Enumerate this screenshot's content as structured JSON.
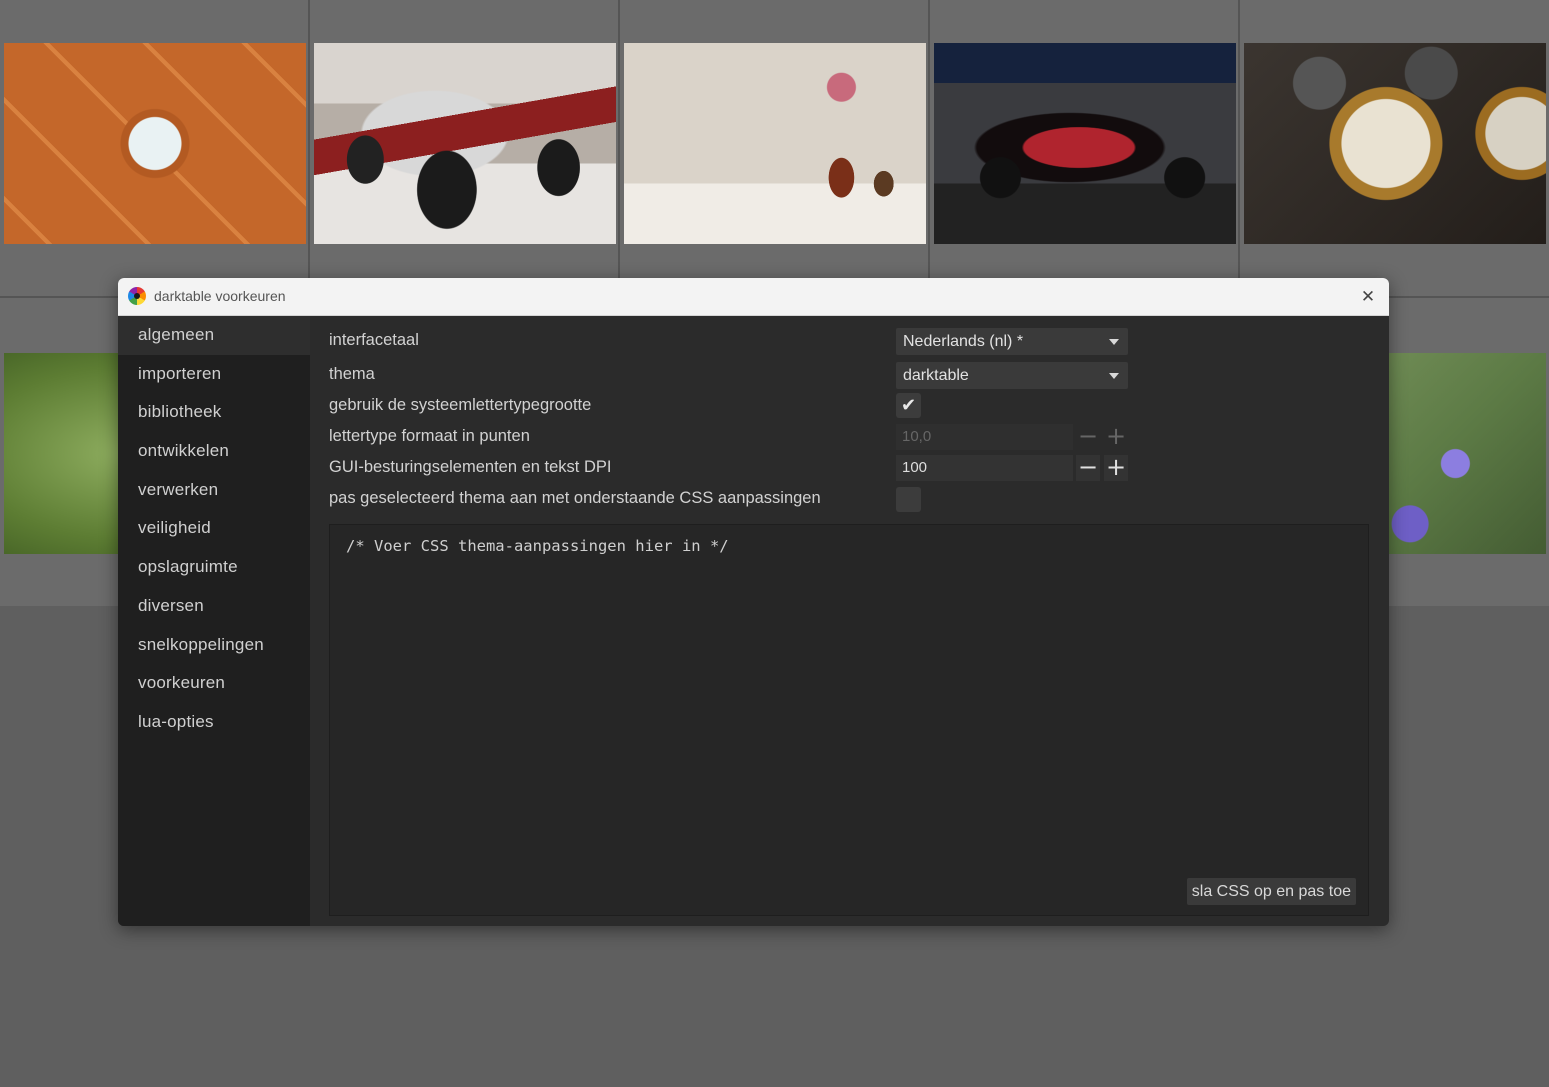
{
  "window": {
    "title": "darktable voorkeuren",
    "close_glyph": "✕"
  },
  "sidebar": {
    "items": [
      {
        "label": "algemeen"
      },
      {
        "label": "importeren"
      },
      {
        "label": "bibliotheek"
      },
      {
        "label": "ontwikkelen"
      },
      {
        "label": "verwerken"
      },
      {
        "label": "veiligheid"
      },
      {
        "label": "opslagruimte"
      },
      {
        "label": "diversen"
      },
      {
        "label": "snelkoppelingen"
      },
      {
        "label": "voorkeuren"
      },
      {
        "label": "lua-opties"
      }
    ],
    "active_index": 0
  },
  "settings": {
    "interface_language": {
      "label": "interfacetaal",
      "value": "Nederlands (nl) *"
    },
    "theme": {
      "label": "thema",
      "value": "darktable"
    },
    "system_font_size": {
      "label": "gebruik de systeemlettertypegrootte",
      "checked": true
    },
    "font_size": {
      "label": "lettertype formaat in punten",
      "value": "10,0",
      "disabled": true
    },
    "dpi": {
      "label": "GUI-besturingselementen en tekst DPI",
      "value": "100"
    },
    "css_tweaks": {
      "label": "pas geselecteerd thema aan met onderstaande CSS aanpassingen",
      "checked": false
    }
  },
  "spin_glyphs": {
    "minus": "−",
    "plus": "+"
  },
  "css_editor": {
    "text": "/* Voer CSS thema-aanpassingen hier in */",
    "save_label": "sla CSS op en pas toe"
  },
  "colors": {
    "dialog_bg": "#2b2b2b",
    "sidebar_bg": "#1f1f1f",
    "titlebar_bg": "#f3f3f3",
    "lighttable_bg": "#5f5f5f"
  }
}
